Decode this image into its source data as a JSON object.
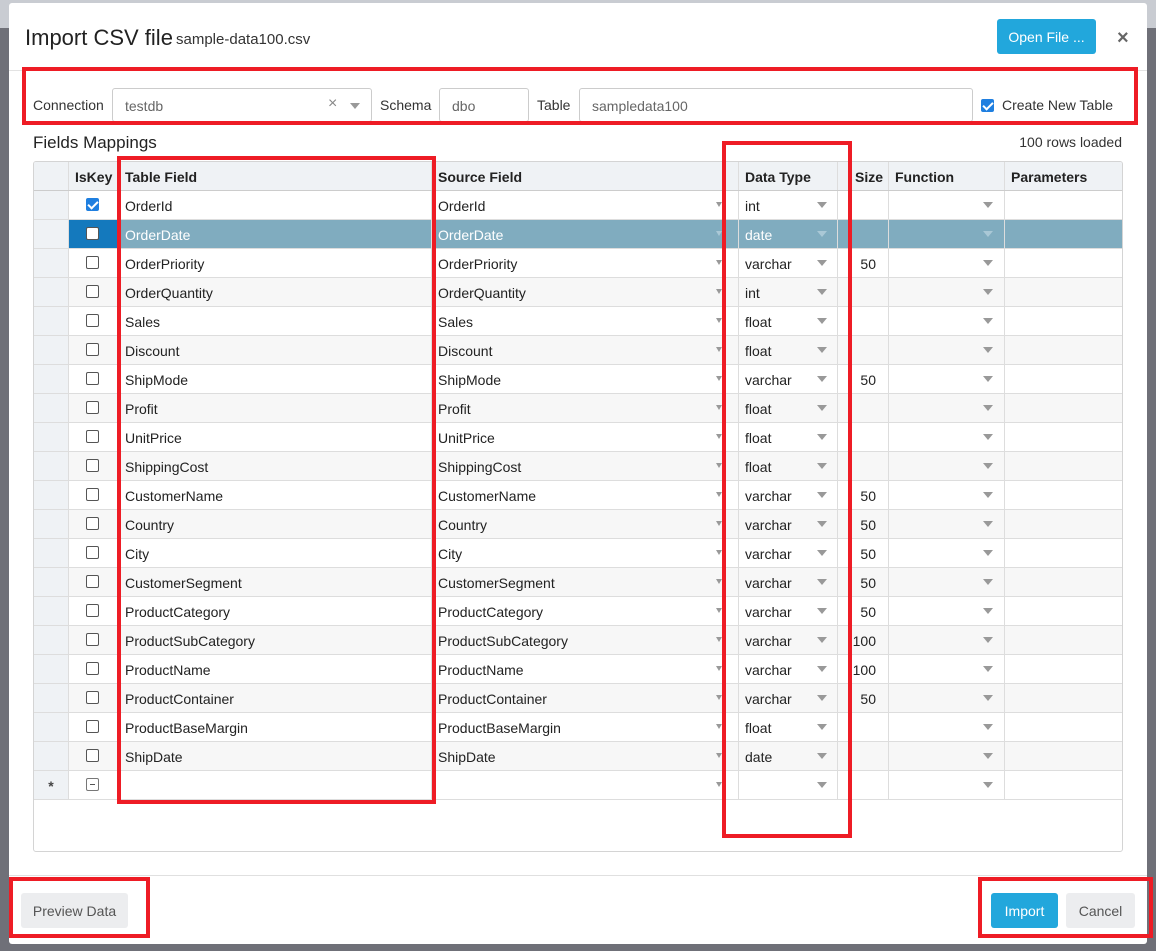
{
  "dialog": {
    "title": "Import CSV file",
    "file_name": "sample-data100.csv",
    "open_file_label": "Open File ...",
    "close_icon": "close-icon"
  },
  "form": {
    "connection_label": "Connection",
    "connection_value": "testdb",
    "schema_label": "Schema",
    "schema_value": "dbo",
    "table_label": "Table",
    "table_value": "sampledata100",
    "create_new_table_label": "Create New Table",
    "create_new_table_checked": true
  },
  "mappings": {
    "title": "Fields Mappings",
    "rows_loaded": "100 rows loaded",
    "columns": [
      "IsKey",
      "Table Field",
      "Source Field",
      "Data Type",
      "Size",
      "Function",
      "Parameters"
    ],
    "new_row_marker": "*",
    "selected_row": 1,
    "rows": [
      {
        "key": true,
        "table_field": "OrderId",
        "source_field": "OrderId",
        "type": "int",
        "size": ""
      },
      {
        "key": false,
        "table_field": "OrderDate",
        "source_field": "OrderDate",
        "type": "date",
        "size": ""
      },
      {
        "key": false,
        "table_field": "OrderPriority",
        "source_field": "OrderPriority",
        "type": "varchar",
        "size": "50"
      },
      {
        "key": false,
        "table_field": "OrderQuantity",
        "source_field": "OrderQuantity",
        "type": "int",
        "size": ""
      },
      {
        "key": false,
        "table_field": "Sales",
        "source_field": "Sales",
        "type": "float",
        "size": ""
      },
      {
        "key": false,
        "table_field": "Discount",
        "source_field": "Discount",
        "type": "float",
        "size": ""
      },
      {
        "key": false,
        "table_field": "ShipMode",
        "source_field": "ShipMode",
        "type": "varchar",
        "size": "50"
      },
      {
        "key": false,
        "table_field": "Profit",
        "source_field": "Profit",
        "type": "float",
        "size": ""
      },
      {
        "key": false,
        "table_field": "UnitPrice",
        "source_field": "UnitPrice",
        "type": "float",
        "size": ""
      },
      {
        "key": false,
        "table_field": "ShippingCost",
        "source_field": "ShippingCost",
        "type": "float",
        "size": ""
      },
      {
        "key": false,
        "table_field": "CustomerName",
        "source_field": "CustomerName",
        "type": "varchar",
        "size": "50"
      },
      {
        "key": false,
        "table_field": "Country",
        "source_field": "Country",
        "type": "varchar",
        "size": "50"
      },
      {
        "key": false,
        "table_field": "City",
        "source_field": "City",
        "type": "varchar",
        "size": "50"
      },
      {
        "key": false,
        "table_field": "CustomerSegment",
        "source_field": "CustomerSegment",
        "type": "varchar",
        "size": "50"
      },
      {
        "key": false,
        "table_field": "ProductCategory",
        "source_field": "ProductCategory",
        "type": "varchar",
        "size": "50"
      },
      {
        "key": false,
        "table_field": "ProductSubCategory",
        "source_field": "ProductSubCategory",
        "type": "varchar",
        "size": "100"
      },
      {
        "key": false,
        "table_field": "ProductName",
        "source_field": "ProductName",
        "type": "varchar",
        "size": "100"
      },
      {
        "key": false,
        "table_field": "ProductContainer",
        "source_field": "ProductContainer",
        "type": "varchar",
        "size": "50"
      },
      {
        "key": false,
        "table_field": "ProductBaseMargin",
        "source_field": "ProductBaseMargin",
        "type": "float",
        "size": ""
      },
      {
        "key": false,
        "table_field": "ShipDate",
        "source_field": "ShipDate",
        "type": "date",
        "size": ""
      }
    ]
  },
  "footer": {
    "preview_label": "Preview Data",
    "import_label": "Import",
    "cancel_label": "Cancel"
  },
  "colors": {
    "primary": "#22a7dc",
    "selected_row": "#80acbf",
    "annotation": "#ee1c25"
  }
}
